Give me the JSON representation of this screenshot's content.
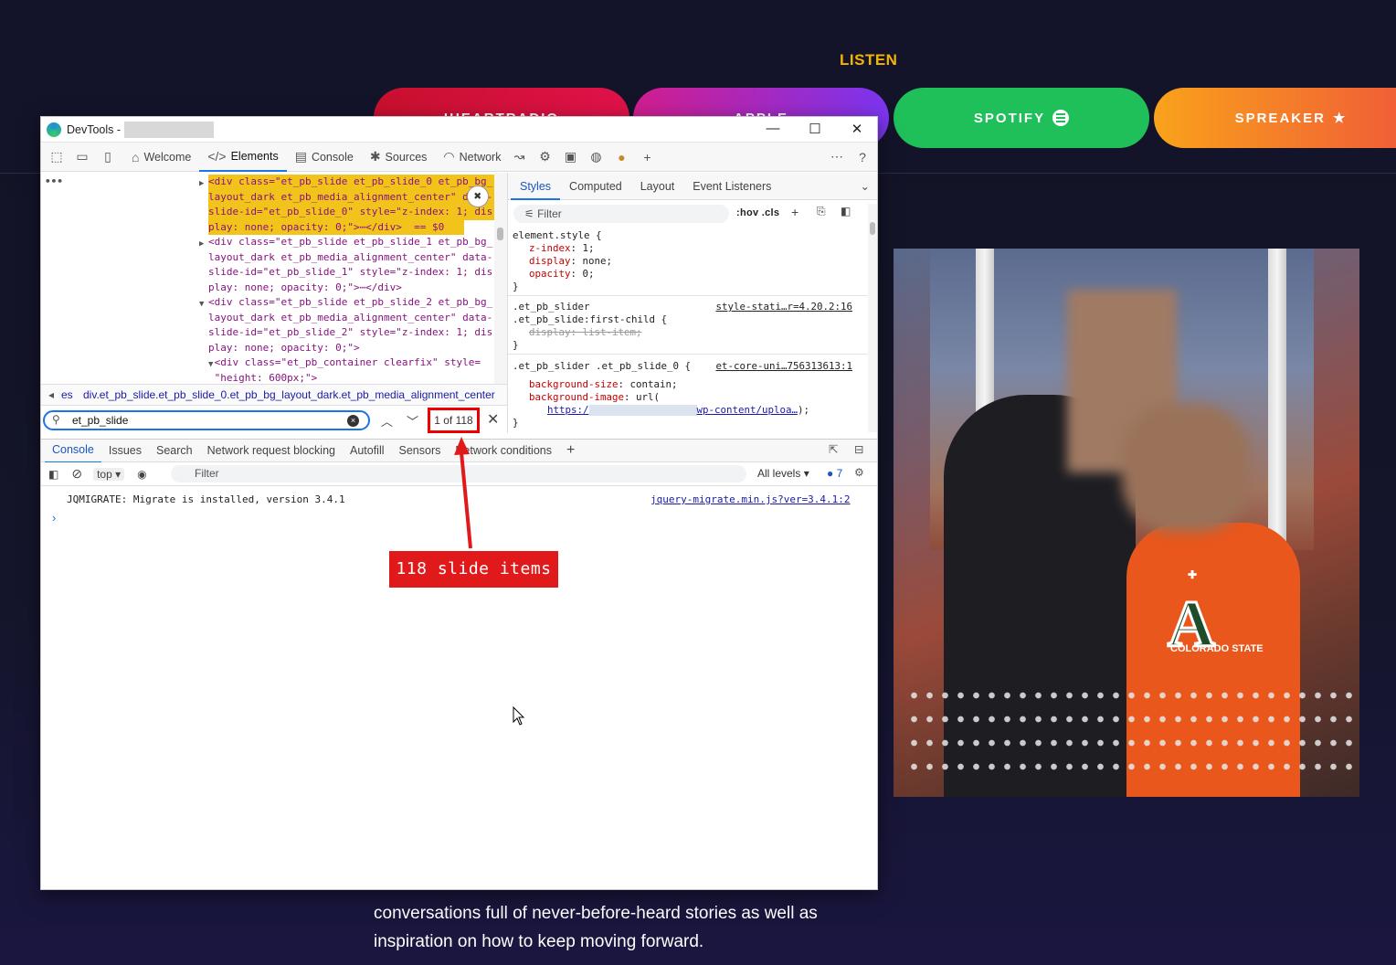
{
  "website": {
    "section_heading": "LISTEN",
    "platforms": [
      {
        "label": "IHEARTRADIO",
        "icon": "iheart-icon",
        "color": "#d6143c"
      },
      {
        "label": "APPLE",
        "icon": "podcast-icon",
        "color": "#9a2fd6"
      },
      {
        "label": "SPOTIFY",
        "icon": "spotify-icon",
        "color": "#1fbf5a"
      },
      {
        "label": "SPREAKER",
        "icon": "star-icon",
        "color": "#f58a2a"
      }
    ],
    "photo_text": {
      "shirt_letter": "A",
      "shirt_caption": "COLORADO STATE"
    },
    "body_text": "conversations full of never-before-heard stories as well as inspiration on how to keep moving forward."
  },
  "devtools": {
    "window_title": "DevTools -",
    "window_controls": {
      "minimize": "—",
      "maximize": "☐",
      "close": "✕"
    },
    "main_tabs": [
      "Welcome",
      "Elements",
      "Console",
      "Sources",
      "Network"
    ],
    "active_main_tab": "Elements",
    "elements_lines": [
      {
        "text": "<div class=\"et_pb_slide et_pb_slide_0 et_pb_bg_",
        "highlight": true,
        "arrow": "▶"
      },
      {
        "text": "layout_dark et_pb_media_alignment_center\" data-",
        "highlight": true
      },
      {
        "text": "slide-id=\"et_pb_slide_0\" style=\"z-index: 1; dis",
        "highlight": true
      },
      {
        "text": "play: none; opacity: 0;\">⋯</div>  == $0",
        "highlight": true
      },
      {
        "text": "<div class=\"et_pb_slide et_pb_slide_1 et_pb_bg_",
        "highlight": false,
        "arrow": "▶"
      },
      {
        "text": "layout_dark et_pb_media_alignment_center\" data-",
        "highlight": false
      },
      {
        "text": "slide-id=\"et_pb_slide_1\" style=\"z-index: 1; dis",
        "highlight": false
      },
      {
        "text": "play: none; opacity: 0;\">⋯</div>",
        "highlight": false
      },
      {
        "text": "<div class=\"et_pb_slide et_pb_slide_2 et_pb_bg_",
        "highlight": false,
        "arrow": "▼"
      },
      {
        "text": "layout_dark et_pb_media_alignment_center\" data-",
        "highlight": false
      },
      {
        "text": "slide-id=\"et_pb_slide_2\" style=\"z-index: 1; dis",
        "highlight": false
      },
      {
        "text": "play: none; opacity: 0;\">",
        "highlight": false
      },
      {
        "text": " <div class=\"et_pb_container clearfix\" style=",
        "highlight": false,
        "arrow": "▼"
      },
      {
        "text": " \"height: 600px;\">",
        "highlight": false
      }
    ],
    "breadcrumb_prefix": "es",
    "breadcrumb": "div.et_pb_slide.et_pb_slide_0.et_pb_bg_layout_dark.et_pb_media_alignment_center",
    "search": {
      "value": "et_pb_slide",
      "match_count": "1 of 118"
    },
    "styles_tabs": [
      "Styles",
      "Computed",
      "Layout",
      "Event Listeners"
    ],
    "styles_filter_placeholder": "Filter",
    "styles_toggles": ":hov .cls",
    "rules": [
      {
        "selector": "element.style {",
        "props": [
          {
            "name": "z-index",
            "value": "1;"
          },
          {
            "name": "display",
            "value": "none;"
          },
          {
            "name": "opacity",
            "value": "0;"
          }
        ],
        "close": "}"
      },
      {
        "selector": ".et_pb_slider\n.et_pb_slide:first-child {",
        "source": "style-stati…r=4.20.2:16",
        "props_struck": "display: list-item;",
        "close": "}"
      },
      {
        "selector": ".et_pb_slider .et_pb_slide_0 {",
        "source": "et-core-uni…756313613:1",
        "props": [
          {
            "name": "background-size",
            "value": "contain;"
          },
          {
            "name": "background-image",
            "value": "url("
          }
        ],
        "url_start": "https:/",
        "url_end": "wp-content/uploa…",
        "url_suffix": ");",
        "close": "}"
      }
    ],
    "drawer_tabs": [
      "Console",
      "Issues",
      "Search",
      "Network request blocking",
      "Autofill",
      "Sensors",
      "Network conditions"
    ],
    "active_drawer_tab": "Console",
    "console_toolbar": {
      "context": "top",
      "filter_placeholder": "Filter",
      "levels": "All levels",
      "issues_count": "7"
    },
    "console_message": {
      "text": "JQMIGRATE: Migrate is installed, version 3.4.1",
      "source": "jquery-migrate.min.js?ver=3.4.1:2"
    },
    "console_prompt": "›"
  },
  "annotation": {
    "callout_text": "118 slide items",
    "color": "#e01a1a"
  }
}
